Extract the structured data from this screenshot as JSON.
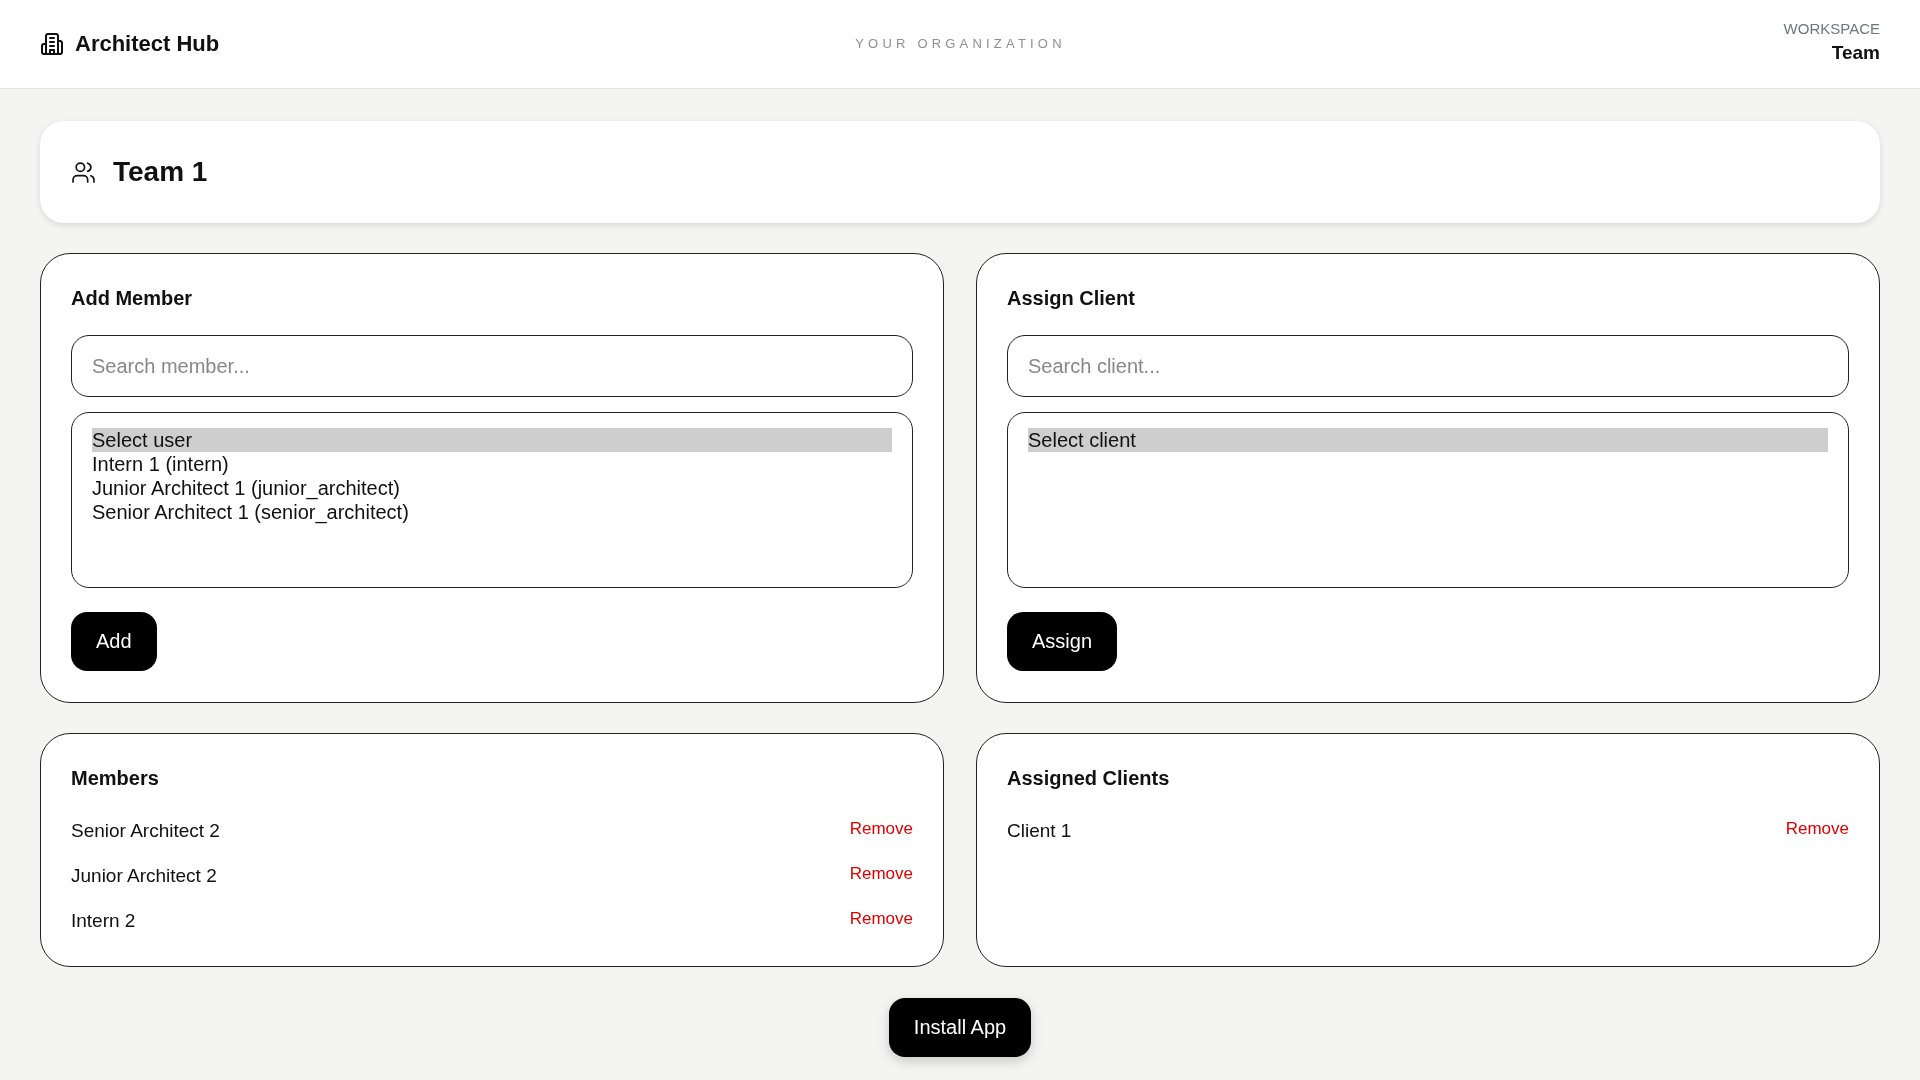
{
  "header": {
    "brand": "Architect Hub",
    "organization": "YOUR ORGANIZATION",
    "workspace_label": "WORKSPACE",
    "workspace": "Team"
  },
  "team": {
    "name": "Team 1"
  },
  "panels": [
    {
      "title": "Add Member",
      "search": {
        "placeholder": "Search member..."
      },
      "options": [
        {
          "label": "Select user",
          "selected": true
        },
        {
          "label": "Intern 1 (intern)",
          "selected": false
        },
        {
          "label": "Junior Architect 1 (junior_architect)",
          "selected": false
        },
        {
          "label": "Senior Architect 1 (senior_architect)",
          "selected": false
        }
      ],
      "button": "Add"
    },
    {
      "title": "Assign Client",
      "search": {
        "placeholder": "Search client..."
      },
      "options": [
        {
          "label": "Select client",
          "selected": true
        }
      ],
      "button": "Assign"
    }
  ],
  "lists": [
    {
      "title": "Members",
      "items": [
        {
          "name": "Senior Architect 2",
          "action": "Remove"
        },
        {
          "name": "Junior Architect 2",
          "action": "Remove"
        },
        {
          "name": "Intern 2",
          "action": "Remove"
        }
      ]
    },
    {
      "title": "Assigned Clients",
      "items": [
        {
          "name": "Client 1",
          "action": "Remove"
        }
      ]
    }
  ],
  "install_button": "Install App"
}
